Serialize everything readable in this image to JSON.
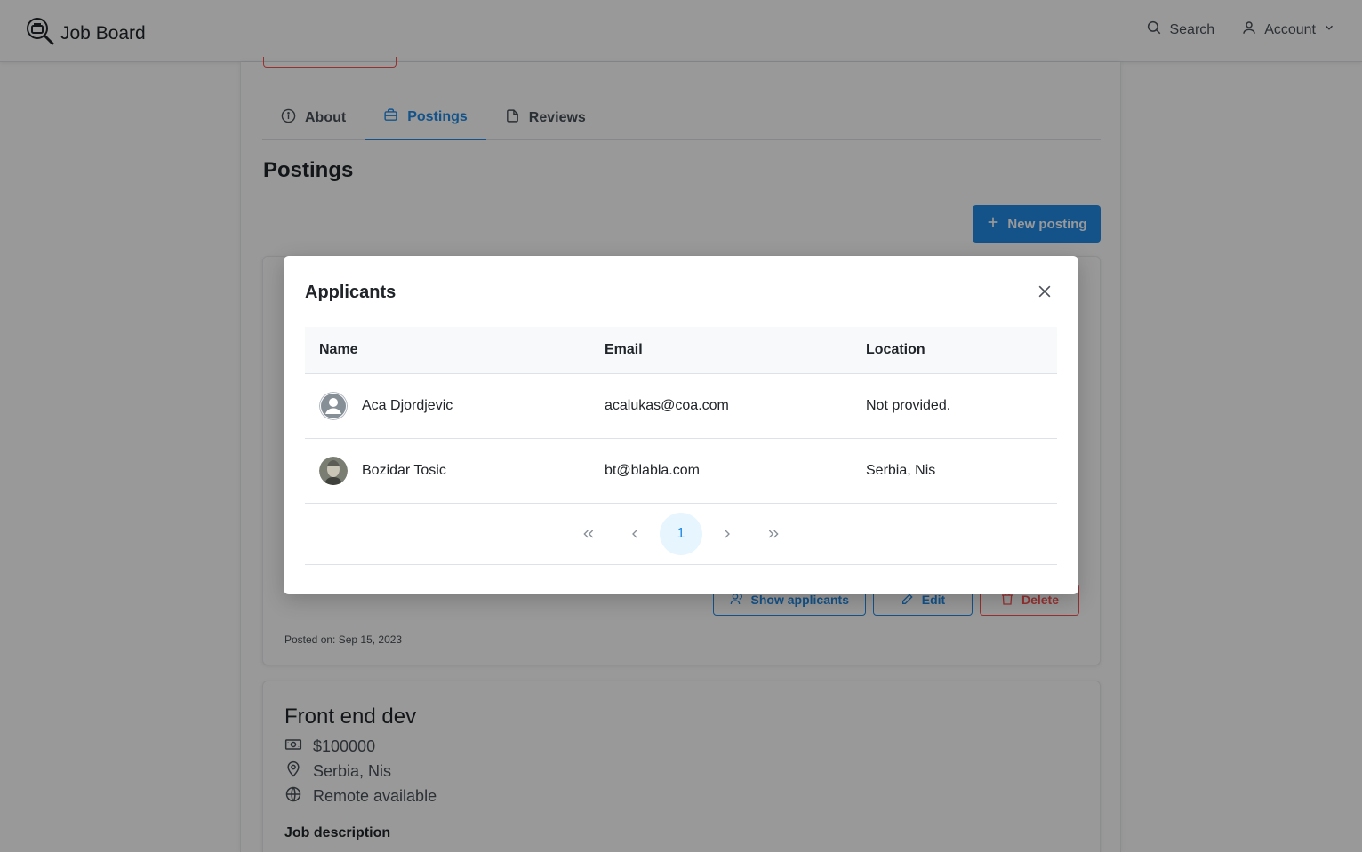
{
  "header": {
    "brand": "Job Board",
    "search_label": "Search",
    "account_label": "Account"
  },
  "tabs": [
    {
      "label": "About",
      "icon": "info-icon"
    },
    {
      "label": "Postings",
      "icon": "briefcase-icon",
      "active": true
    },
    {
      "label": "Reviews",
      "icon": "file-icon"
    }
  ],
  "page": {
    "title": "Postings",
    "new_posting_label": "New posting"
  },
  "posting_card": {
    "actions": {
      "show_applicants": "Show applicants",
      "edit": "Edit",
      "delete": "Delete"
    },
    "posted_on": "Posted on: Sep 15, 2023"
  },
  "second_posting": {
    "title": "Front end dev",
    "salary": "$100000",
    "location": "Serbia, Nis",
    "remote": "Remote available",
    "description_label": "Job description"
  },
  "modal": {
    "title": "Applicants",
    "columns": [
      "Name",
      "Email",
      "Location"
    ],
    "rows": [
      {
        "name": "Aca Djordjevic",
        "email": "acalukas@coa.com",
        "location": "Not provided.",
        "avatar": "default-avatar"
      },
      {
        "name": "Bozidar Tosic",
        "email": "bt@blabla.com",
        "location": "Serbia, Nis",
        "avatar": "photo-avatar"
      }
    ],
    "pagination": {
      "current_page": "1"
    }
  },
  "colors": {
    "accent": "#228be6",
    "danger": "#fa5252",
    "overlay": "rgba(0,0,0,0.4)"
  }
}
